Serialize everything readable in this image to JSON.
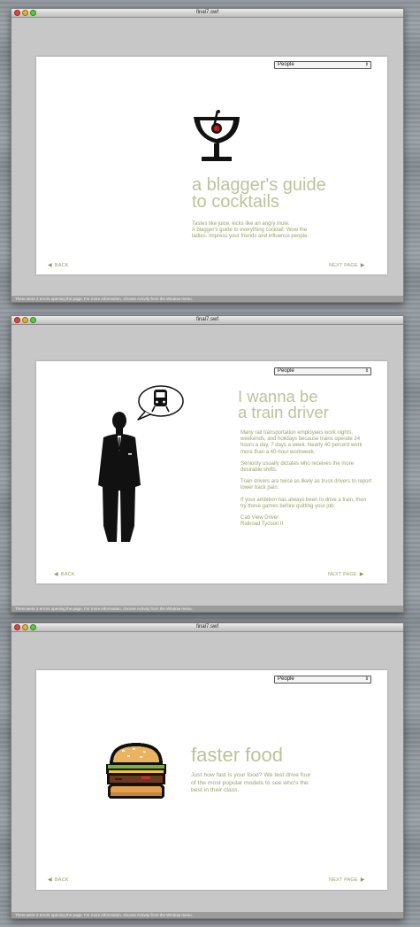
{
  "windows": [
    {
      "title": "final7.swf",
      "status": "There were 2 errors opening the page. For more information, choose Activity from the Window menu.",
      "dropdown": {
        "selected": "People",
        "arrow": "⇕"
      },
      "nav": {
        "back": "BACK",
        "next": "NEXT PAGE"
      },
      "icon": "cocktail-glass-icon",
      "heading": [
        "a blagger's guide",
        "to cocktails"
      ],
      "body": [
        "Tastes like juice, kicks like an angry mule.",
        "A blagger's guide to everything cocktail. Wow the",
        "ladies. Impress your friends and influence people."
      ]
    },
    {
      "title": "final7.swf",
      "status": "There were 2 errors opening the page. For more information, choose Activity from the Window menu.",
      "dropdown": {
        "selected": "People",
        "arrow": "⇕"
      },
      "nav": {
        "back": "BACK",
        "next": "NEXT PAGE"
      },
      "icon": "man-with-train-thought-icon",
      "heading": [
        "I wanna be",
        "a train driver"
      ],
      "paragraphs": [
        "Many rail transportation employees work nights, weekends, and holidays because trains operate 24 hours a day, 7 days a week. Nearly 40 percent work more than a 40-hour workweek.",
        "Seniority usually dictates who receives the more desirable shifts.",
        "Train drivers are twice as likely as truck drivers to report lower back pain.",
        "If your ambition has always been to drive a train, then try these games before quitting your job:"
      ],
      "games": [
        "Cab View Driver",
        "Railroad Tycoon II"
      ]
    },
    {
      "title": "final7.swf",
      "status": "There were 2 errors opening the page. For more information, choose Activity from the Window menu.",
      "dropdown": {
        "selected": "People",
        "arrow": "⇕"
      },
      "nav": {
        "back": "BACK",
        "next": "NEXT PAGE"
      },
      "icon": "burger-icon",
      "heading": [
        "faster food"
      ],
      "body": [
        "Just how fast is your food? We test drive four",
        "of the most popular models to see who's the",
        "best in their class."
      ]
    }
  ],
  "colors": {
    "accent": "#9aa26a",
    "heading": "#bcc39a"
  }
}
